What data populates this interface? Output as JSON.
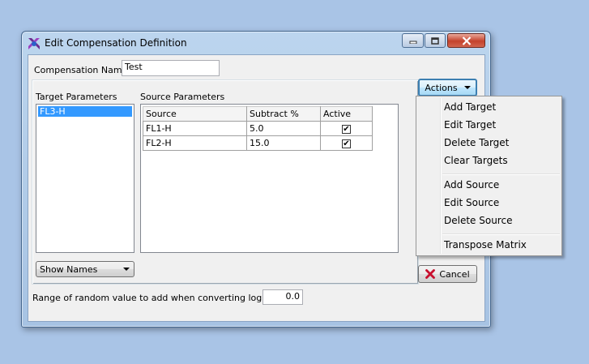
{
  "window": {
    "title": "Edit Compensation Definition"
  },
  "compensation_name": {
    "label": "Compensation Name",
    "value": "Test"
  },
  "target_parameters": {
    "label": "Target Parameters",
    "items": [
      "FL3-H"
    ]
  },
  "source_parameters": {
    "label": "Source Parameters",
    "columns": [
      "Source",
      "Subtract %",
      "Active"
    ],
    "rows": [
      {
        "source": "FL1-H",
        "subtract": "5.0",
        "active": true
      },
      {
        "source": "FL2-H",
        "subtract": "15.0",
        "active": true
      }
    ]
  },
  "show_names": {
    "selected": "Show Names"
  },
  "actions_button": {
    "label": "Actions"
  },
  "cancel_button": {
    "label": "Cancel"
  },
  "random_range": {
    "label": "Range of random value to add when converting log data",
    "value": "0.0"
  },
  "actions_menu": {
    "items": [
      "Add Target",
      "Edit Target",
      "Delete Target",
      "Clear Targets",
      "Add Source",
      "Edit Source",
      "Delete Source",
      "Transpose Matrix"
    ]
  },
  "colors": {
    "selection": "#3399ff",
    "desktop": "#a9c4e6",
    "close_button": "#c4422c",
    "cancel_icon": "#c8102e"
  },
  "icons": {
    "app": "fcs-express-icon",
    "minimize": "minimize-icon",
    "maximize": "maximize-icon",
    "close": "close-icon",
    "dropdown": "chevron-down-icon",
    "cancel": "x-mark-icon",
    "check": "checkmark-icon"
  }
}
